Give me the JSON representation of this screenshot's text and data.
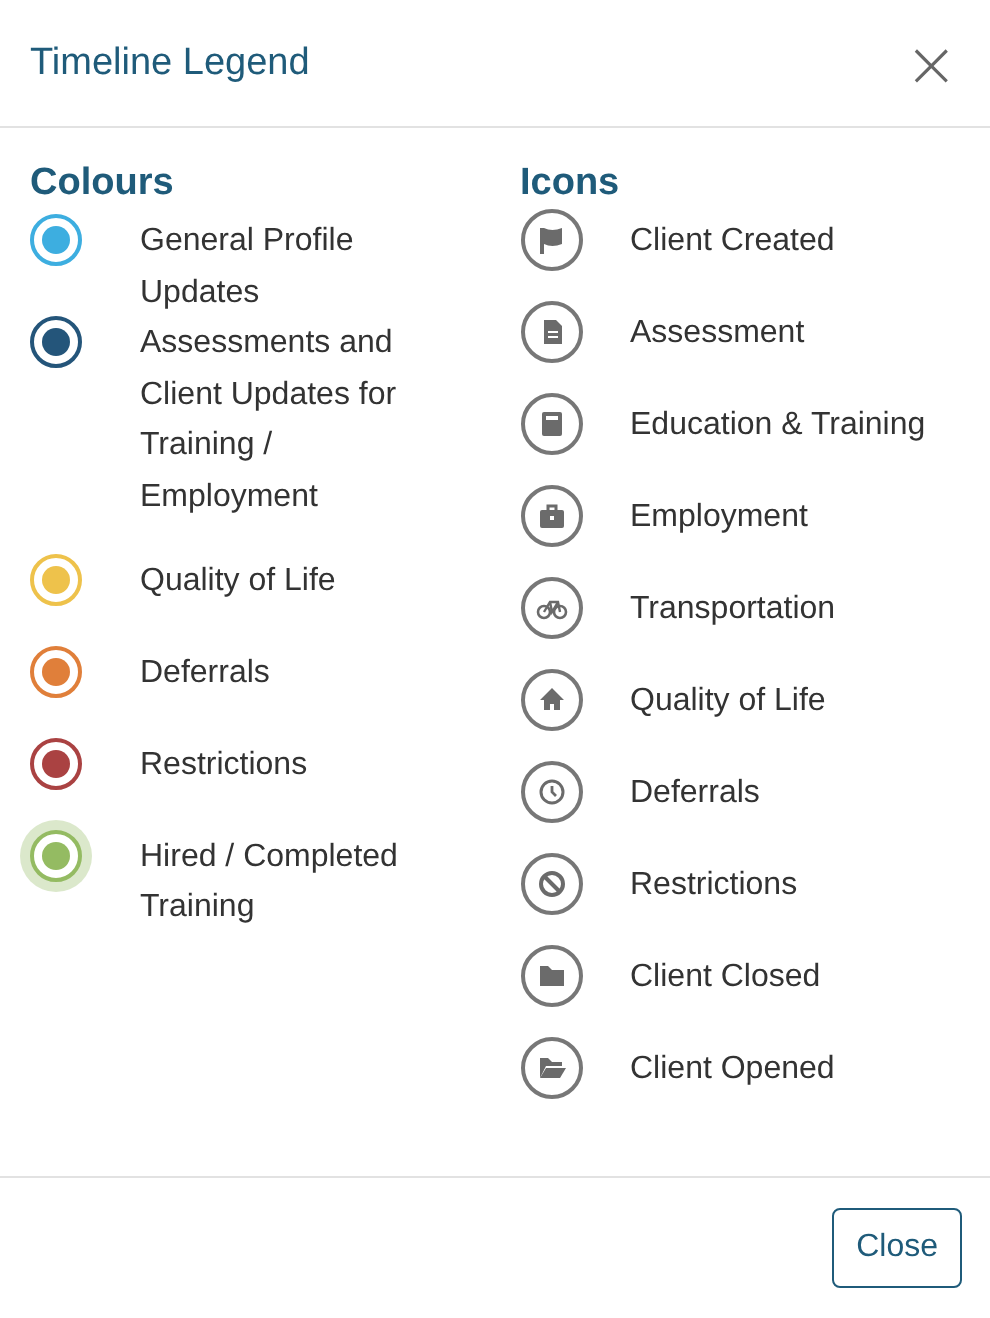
{
  "dialog": {
    "title": "Timeline Legend",
    "close_icon": "×"
  },
  "colours": {
    "heading": "Colours",
    "items": [
      {
        "label": "General Profile Updates",
        "color": "#3daee0",
        "halo": false
      },
      {
        "label": "Assessments and Client Updates for Training / Employment",
        "color": "#24557a",
        "halo": false
      },
      {
        "label": "Quality of Life",
        "color": "#eec24b",
        "halo": false
      },
      {
        "label": "Deferrals",
        "color": "#e07f3a",
        "halo": false
      },
      {
        "label": "Restrictions",
        "color": "#aa4242",
        "halo": false
      },
      {
        "label": "Hired / Completed Training",
        "color": "#94bb62",
        "halo": true
      }
    ]
  },
  "icons": {
    "heading": "Icons",
    "items": [
      {
        "label": "Client Created",
        "kind": "flag"
      },
      {
        "label": "Assessment",
        "kind": "document"
      },
      {
        "label": "Education & Training",
        "kind": "book"
      },
      {
        "label": "Employment",
        "kind": "briefcase"
      },
      {
        "label": "Transportation",
        "kind": "bicycle"
      },
      {
        "label": "Quality of Life",
        "kind": "house"
      },
      {
        "label": "Deferrals",
        "kind": "clock"
      },
      {
        "label": "Restrictions",
        "kind": "ban"
      },
      {
        "label": "Client Closed",
        "kind": "folder"
      },
      {
        "label": "Client Opened",
        "kind": "folder-open"
      }
    ]
  },
  "footer": {
    "button": "Close"
  }
}
